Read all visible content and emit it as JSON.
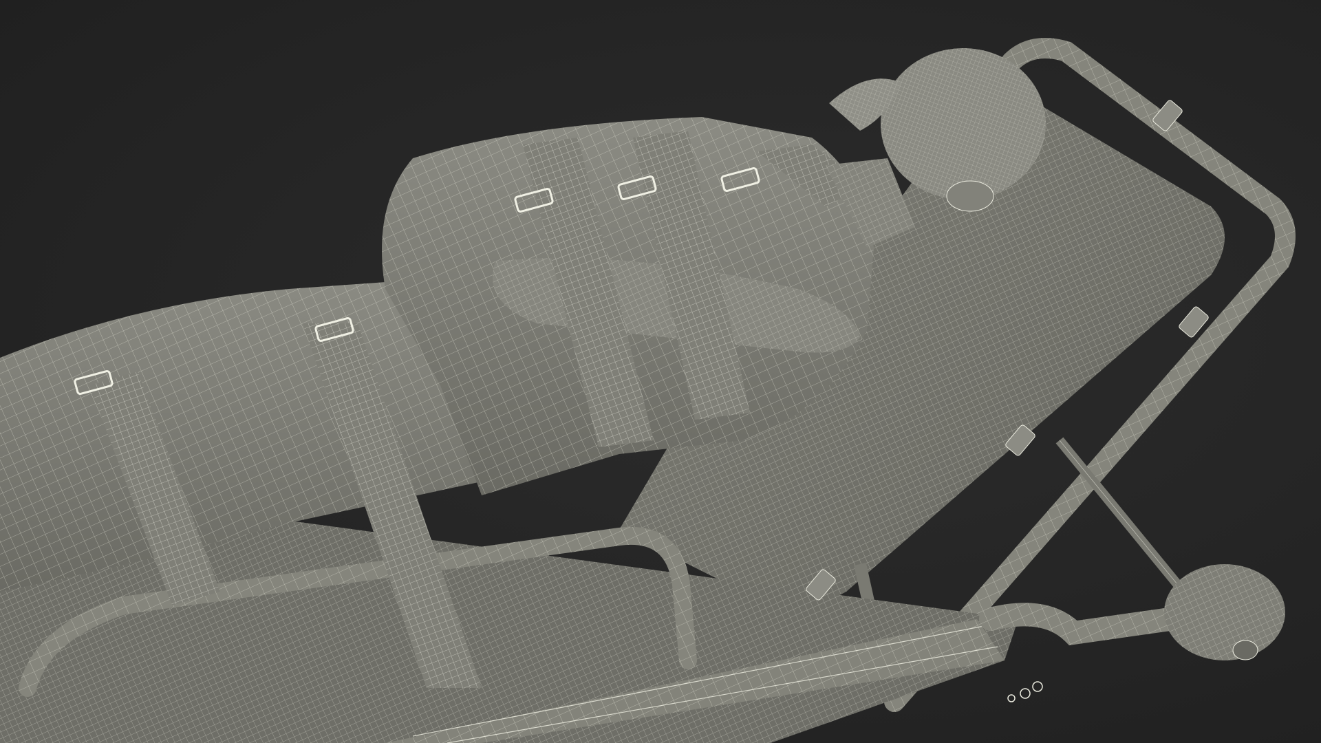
{
  "scene": {
    "subject": "stretcher-with-restrained-figure-wireframe",
    "colors": {
      "background": "#262626",
      "surface": "#7c7c74",
      "surface_dark": "#5f5f58",
      "surface_light": "#8d8d84",
      "wire": "#e8e8dc",
      "frame": "#85857c"
    }
  }
}
